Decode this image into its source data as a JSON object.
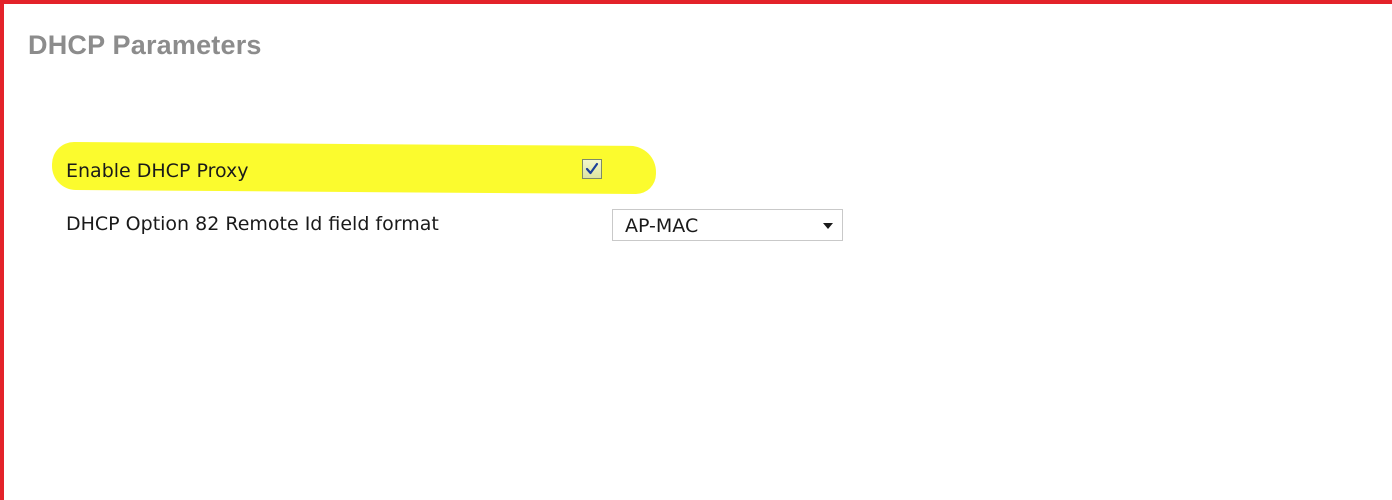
{
  "page": {
    "title": "DHCP Parameters"
  },
  "form": {
    "dhcp_proxy": {
      "label": "Enable DHCP Proxy",
      "checked": true
    },
    "remote_id_format": {
      "label": "DHCP Option 82 Remote Id field format",
      "value": "AP-MAC"
    }
  },
  "colors": {
    "frame_border": "#e3222a",
    "title_text": "#8c8c8c",
    "highlight": "#fbfb2e",
    "checkbox_fill": "#e8efb4"
  },
  "icons": {
    "checkbox": "checkmark-icon",
    "dropdown": "caret-down-icon"
  }
}
